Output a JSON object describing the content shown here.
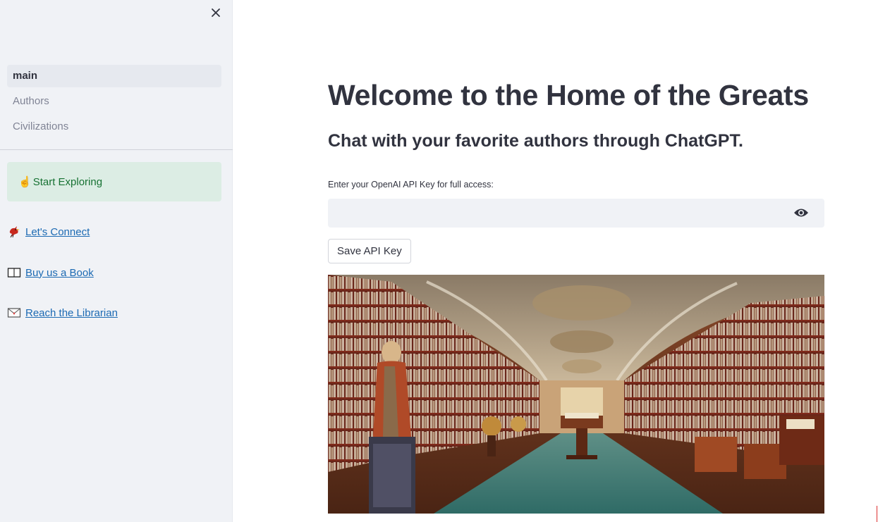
{
  "sidebar": {
    "nav": [
      {
        "label": "main",
        "active": true
      },
      {
        "label": "Authors",
        "active": false
      },
      {
        "label": "Civilizations",
        "active": false
      }
    ],
    "alert": {
      "emoji": "☝️",
      "text": "Start Exploring"
    },
    "links": [
      {
        "icon": "cardinal-bird-icon",
        "label": "Let's Connect"
      },
      {
        "icon": "book-icon",
        "label": "Buy us a Book"
      },
      {
        "icon": "envelope-icon",
        "label": "Reach the Librarian"
      }
    ]
  },
  "main": {
    "title": "Welcome to the Home of the Greats",
    "subtitle": "Chat with your favorite authors through ChatGPT.",
    "api_input": {
      "label": "Enter your OpenAI API Key for full access:",
      "value": ""
    },
    "save_label": "Save API Key"
  },
  "colors": {
    "sidebar_bg": "#f0f2f6",
    "alert_bg": "#dcede4",
    "alert_text": "#177233",
    "link": "#1c6ab3",
    "text": "#31333f"
  }
}
